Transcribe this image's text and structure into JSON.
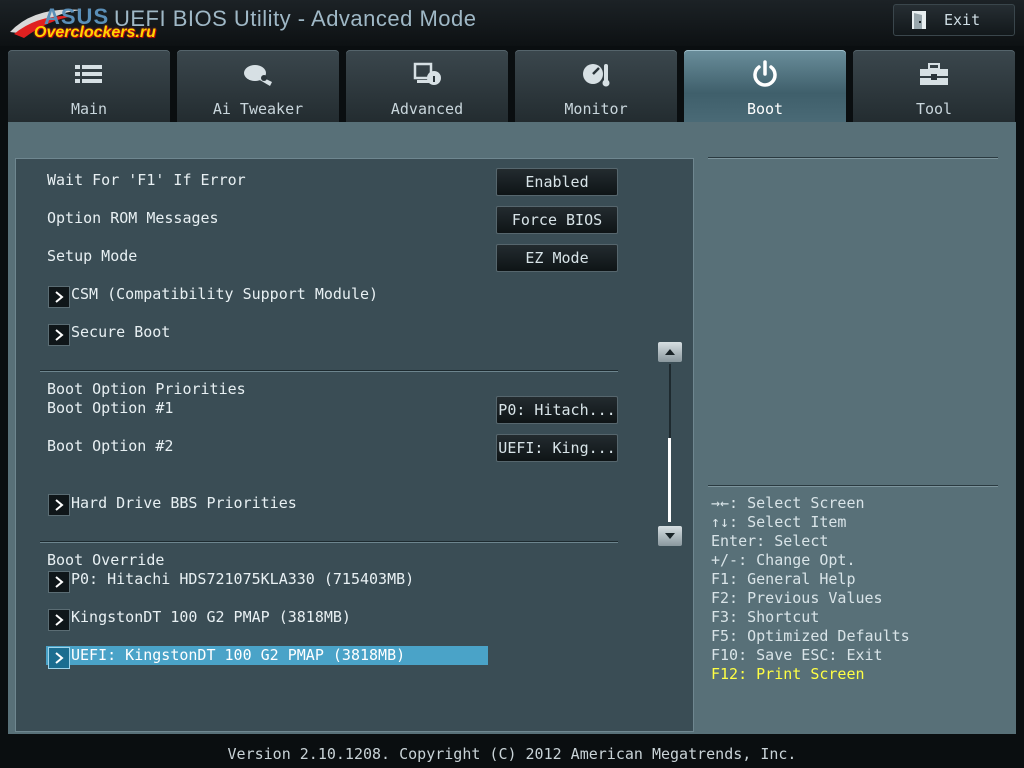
{
  "app": {
    "title": "UEFI BIOS Utility - Advanced Mode",
    "logo_brand": "ASUS",
    "logo_watermark": "Overclockers.ru",
    "exit_label": "Exit"
  },
  "tabs": [
    {
      "label": "Main",
      "icon": "menu-list-icon"
    },
    {
      "label": "Ai Tweaker",
      "icon": "tweaker-icon"
    },
    {
      "label": "Advanced",
      "icon": "advanced-icon"
    },
    {
      "label": "Monitor",
      "icon": "monitor-gauge-icon"
    },
    {
      "label": "Boot",
      "icon": "power-icon",
      "active": true
    },
    {
      "label": "Tool",
      "icon": "toolbox-icon"
    }
  ],
  "settings": {
    "wait_f1": {
      "label": "Wait For 'F1' If Error",
      "value": "Enabled"
    },
    "option_rom": {
      "label": "Option ROM Messages",
      "value": "Force BIOS"
    },
    "setup_mode": {
      "label": "Setup Mode",
      "value": "EZ Mode"
    },
    "csm": "CSM (Compatibility Support Module)",
    "secure_boot": "Secure Boot"
  },
  "boot_priorities": {
    "header": "Boot Option Priorities",
    "option1": {
      "label": "Boot Option #1",
      "value": "P0: Hitach..."
    },
    "option2": {
      "label": "Boot Option #2",
      "value": "UEFI: King..."
    },
    "hdd_bbs": "Hard Drive BBS Priorities"
  },
  "boot_override": {
    "header": "Boot Override",
    "items": [
      "P0: Hitachi HDS721075KLA330  (715403MB)",
      "KingstonDT 100 G2 PMAP  (3818MB)",
      "UEFI: KingstonDT 100 G2 PMAP (3818MB)"
    ],
    "selected_index": 2
  },
  "help": [
    "→←: Select Screen",
    "↑↓: Select Item",
    "Enter: Select",
    "+/-: Change Opt.",
    "F1: General Help",
    "F2: Previous Values",
    "F3: Shortcut",
    "F5: Optimized Defaults",
    "F10: Save  ESC: Exit",
    "F12: Print Screen"
  ],
  "footer": "Version 2.10.1208. Copyright (C) 2012 American Megatrends, Inc.",
  "colors": {
    "highlight": "#4aa3c8",
    "accent_text": "#ffff44",
    "panel": "#3a4d55"
  }
}
